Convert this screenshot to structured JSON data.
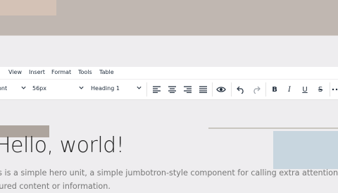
{
  "menubar": {
    "items": [
      "t",
      "View",
      "Insert",
      "Format",
      "Tools",
      "Table"
    ]
  },
  "toolbar": {
    "font_family": "ont",
    "font_size": "56px",
    "block_format": "Heading 1",
    "icons": [
      "align-left-icon",
      "align-center-icon",
      "align-right-icon",
      "align-justify-icon",
      "preview-eye-icon",
      "undo-icon",
      "redo-icon",
      "bold-icon",
      "italic-icon",
      "underline-icon",
      "strikethrough-icon",
      "more-icon"
    ],
    "bold_label": "B",
    "italic_label": "I",
    "underline_label": "U",
    "strike_label": "S"
  },
  "content": {
    "title": "Hello, world!",
    "paragraph_line1": "is is a simple hero unit, a simple jumbotron-style component for calling extra attention to",
    "paragraph_line2": "tured content or information."
  },
  "colors": {
    "banner": "#c0b7b1",
    "toolbar_bg": "#ffffff",
    "text_dark": "#222f3e",
    "editor_bg": "#eeedef"
  }
}
